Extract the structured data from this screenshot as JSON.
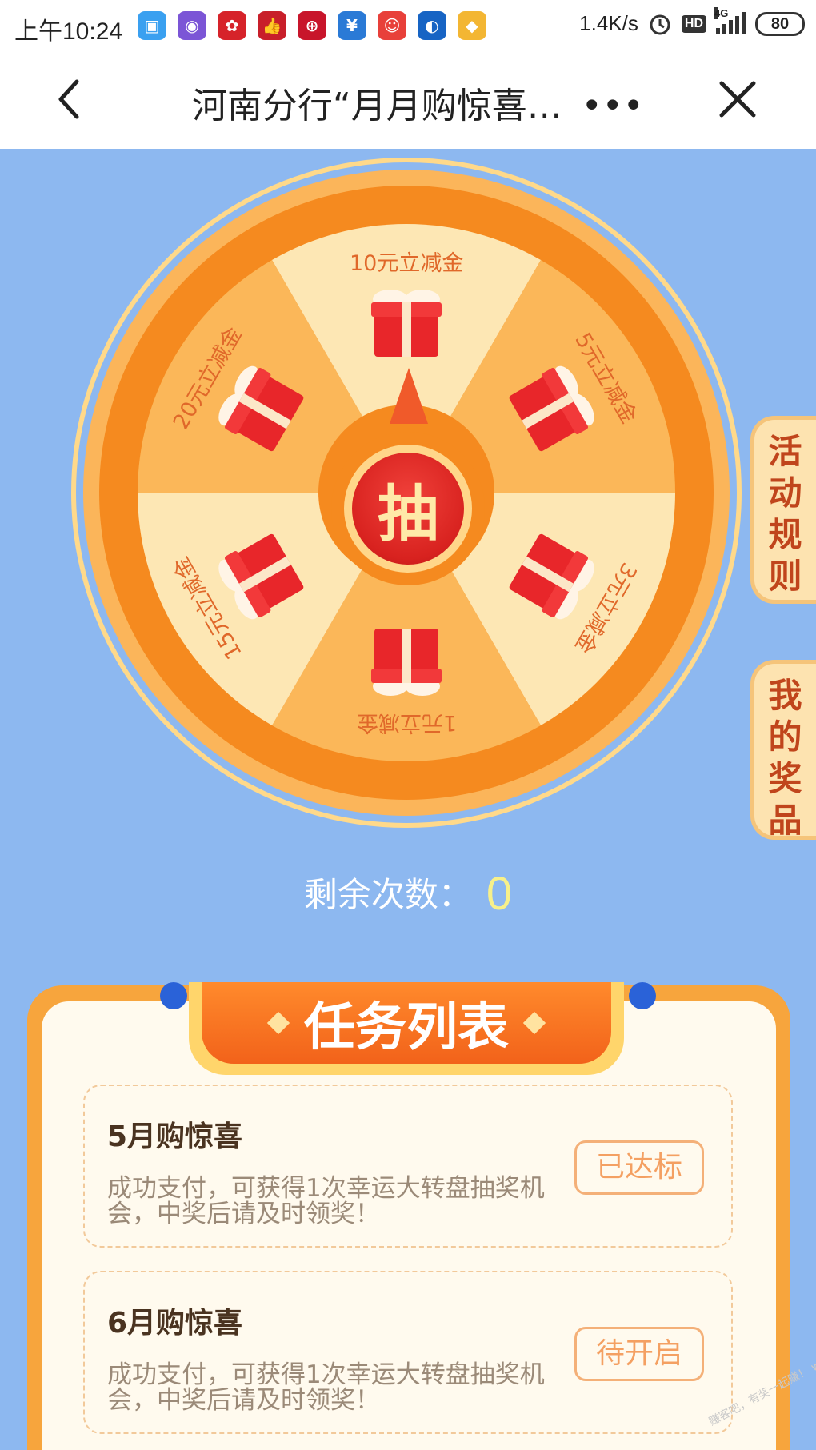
{
  "status_bar": {
    "time": "上午10:24",
    "speed": "1.4K/s",
    "hd": "HD",
    "network": "4G",
    "battery": "80",
    "app_icons": [
      {
        "name": "wallet-icon",
        "color": "#3aa0f0",
        "glyph": "▣"
      },
      {
        "name": "camera-icon",
        "color": "#7b55d6",
        "glyph": "◉"
      },
      {
        "name": "huawei-icon",
        "color": "#d6232a",
        "glyph": "✿"
      },
      {
        "name": "thumb-icon",
        "color": "#c81f2a",
        "glyph": "👍"
      },
      {
        "name": "bank-icon",
        "color": "#c8152b",
        "glyph": "⊕"
      },
      {
        "name": "yuan-icon",
        "color": "#2a7ad6",
        "glyph": "¥"
      },
      {
        "name": "mascot-icon",
        "color": "#e8403a",
        "glyph": "☺"
      },
      {
        "name": "ccb-icon",
        "color": "#1764c4",
        "glyph": "◐"
      },
      {
        "name": "game-icon",
        "color": "#f3b633",
        "glyph": "◆"
      }
    ]
  },
  "nav": {
    "title": "河南分行“月月购惊喜…",
    "more": "•••"
  },
  "wheel": {
    "prizes": [
      "10元立减金",
      "5元立减金",
      "3元立减金",
      "1元立减金",
      "15元立减金",
      "20元立减金"
    ],
    "draw_button": "抽",
    "colors": {
      "outer": "#f58a1f",
      "ring": "#fbb55a",
      "light": "#fde7b4",
      "dark": "#fbb759",
      "accent": "#e0682a"
    }
  },
  "side_tabs": {
    "rules": [
      "活",
      "动",
      "规",
      "则"
    ],
    "prizes": [
      "我",
      "的",
      "奖",
      "品"
    ]
  },
  "remaining": {
    "label": "剩余次数：",
    "count": "0"
  },
  "task_list": {
    "title": "任务列表",
    "tasks": [
      {
        "title": "5月购惊喜",
        "desc": "成功支付，可获得1次幸运大转盘抽奖机会，中奖后请及时领奖！",
        "button": "已达标"
      },
      {
        "title": "6月购惊喜",
        "desc": "成功支付，可获得1次幸运大转盘抽奖机会，中奖后请及时领奖！",
        "button": "待开启"
      }
    ]
  },
  "watermark": "赚客吧，有奖一起赚！ www.zuanke8.com"
}
